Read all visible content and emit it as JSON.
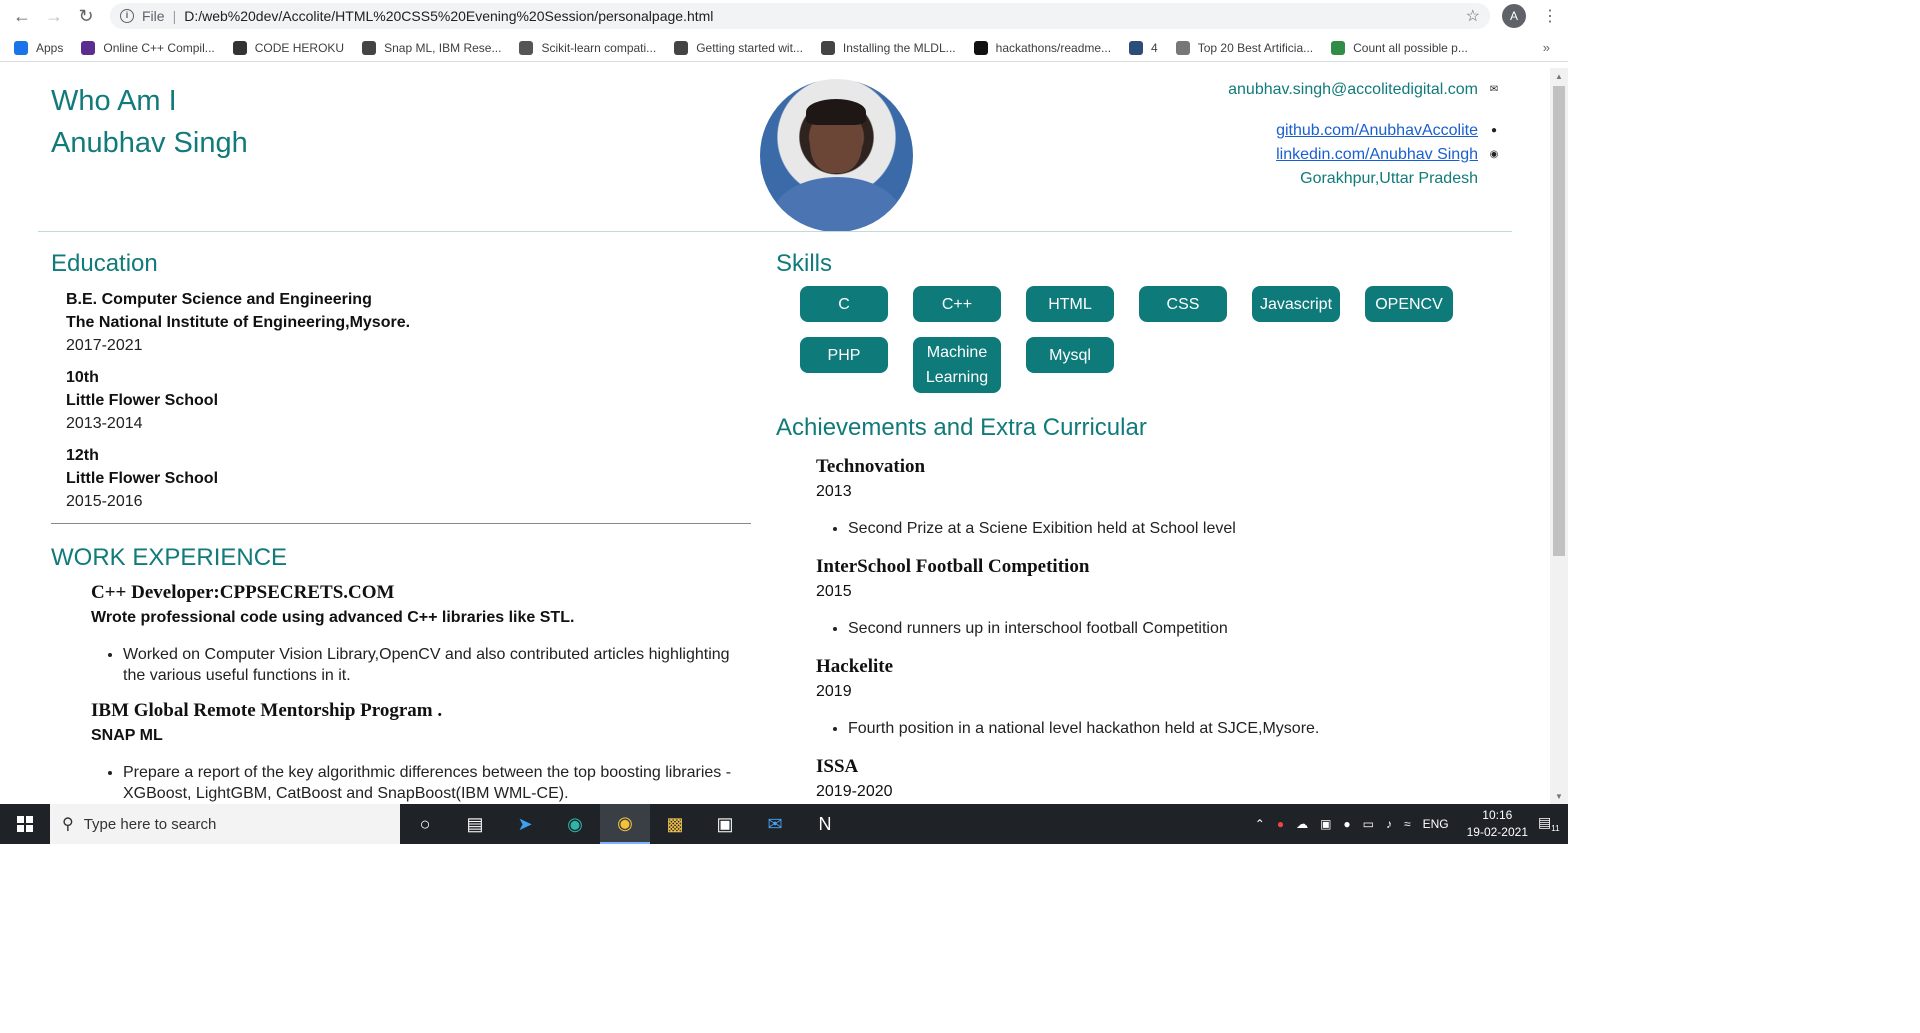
{
  "browser": {
    "url_scheme": "File",
    "url": "D:/web%20dev/Accolite/HTML%20CSS5%20Evening%20Session/personalpage.html",
    "profile_initial": "A",
    "bookmarks": [
      {
        "label": "Apps",
        "icon": "apps-grid-icon",
        "color": "#1a73e8"
      },
      {
        "label": "Online C++ Compil...",
        "icon": "lightning-icon",
        "color": "#5b2d8e"
      },
      {
        "label": "CODE HEROKU",
        "icon": "heroku-icon",
        "color": "#333333"
      },
      {
        "label": "Snap ML, IBM Rese...",
        "icon": "snap-icon",
        "color": "#444444"
      },
      {
        "label": "Scikit-learn compati...",
        "icon": "doc-icon",
        "color": "#555555"
      },
      {
        "label": "Getting started wit...",
        "icon": "snap-icon",
        "color": "#444444"
      },
      {
        "label": "Installing the MLDL...",
        "icon": "snap-icon",
        "color": "#444444"
      },
      {
        "label": "hackathons/readme...",
        "icon": "github-icon",
        "color": "#111111"
      },
      {
        "label": "4",
        "icon": "tds-icon",
        "color": "#2a4d7a"
      },
      {
        "label": "Top 20 Best Artificia...",
        "icon": "circle-a-icon",
        "color": "#777777"
      },
      {
        "label": "Count all possible p...",
        "icon": "gfg-icon",
        "color": "#2f8d46"
      }
    ],
    "more": "»"
  },
  "profile": {
    "heading": "Who Am I",
    "name": "Anubhav Singh",
    "email": "anubhav.singh@accolitedigital.com",
    "github": "github.com/AnubhavAccolite",
    "linkedin": "linkedin.com/Anubhav Singh",
    "location": "Gorakhpur,Uttar Pradesh"
  },
  "education": {
    "title": "Education",
    "items": [
      {
        "degree": "B.E. Computer Science and Engineering",
        "school": "The National Institute of Engineering,Mysore.",
        "years": "2017-2021"
      },
      {
        "degree": "10th",
        "school": "Little Flower School",
        "years": "2013-2014"
      },
      {
        "degree": "12th",
        "school": "Little Flower School",
        "years": "2015-2016"
      }
    ]
  },
  "work": {
    "title": "WORK EXPERIENCE",
    "items": [
      {
        "role": "C++ Developer:CPPSECRETS.COM",
        "summary": "Wrote professional code using advanced C++ libraries like STL.",
        "bullet": "Worked on Computer Vision Library,OpenCV and also contributed articles highlighting the various useful functions in it."
      },
      {
        "role": "IBM Global Remote Mentorship Program .",
        "summary": "SNAP ML",
        "bullet": "Prepare a report of the key algorithmic differences between the top boosting libraries - XGBoost, LightGBM, CatBoost and SnapBoost(IBM WML-CE)."
      }
    ]
  },
  "skills": {
    "title": "Skills",
    "items": [
      "C",
      "C++",
      "HTML",
      "CSS",
      "Javascript",
      "OPENCV",
      "PHP",
      "Machine Learning",
      "Mysql"
    ]
  },
  "achievements": {
    "title": "Achievements and Extra Curricular",
    "items": [
      {
        "name": "Technovation",
        "year": "2013",
        "bullet": "Second Prize at a Sciene Exibition held at School level"
      },
      {
        "name": "InterSchool Football Competition",
        "year": "2015",
        "bullet": "Second runners up in interschool football Competition"
      },
      {
        "name": "Hackelite",
        "year": "2019",
        "bullet": "Fourth position in a national level hackathon held at SJCE,Mysore."
      },
      {
        "name": "ISSA",
        "year": "2019-2020",
        "bullet": ""
      }
    ]
  },
  "taskbar": {
    "search_placeholder": "Type here to search",
    "lang": "ENG",
    "time": "10:16",
    "date": "19-02-2021",
    "notification_count": "11"
  }
}
